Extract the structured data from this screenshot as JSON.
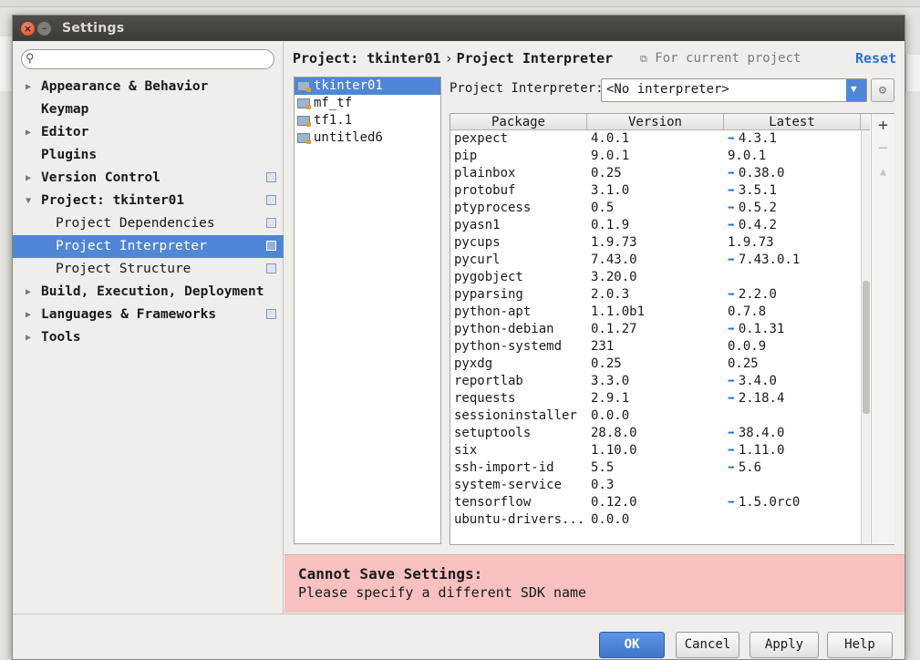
{
  "dialog": {
    "title": "Settings"
  },
  "search": {
    "placeholder": ""
  },
  "nav": [
    {
      "label": "Appearance & Behavior",
      "expandable": true,
      "bold": true
    },
    {
      "label": "Keymap",
      "expandable": false,
      "bold": true
    },
    {
      "label": "Editor",
      "expandable": true,
      "bold": true
    },
    {
      "label": "Plugins",
      "expandable": false,
      "bold": true
    },
    {
      "label": "Version Control",
      "expandable": true,
      "bold": true,
      "project_icon": true
    },
    {
      "label": "Project: tkinter01",
      "expandable": true,
      "expanded": true,
      "bold": true,
      "project_icon": true
    },
    {
      "label": "Project Dependencies",
      "child": true,
      "project_icon": true
    },
    {
      "label": "Project Interpreter",
      "child": true,
      "selected": true,
      "project_icon": true
    },
    {
      "label": "Project Structure",
      "child": true,
      "project_icon": true
    },
    {
      "label": "Build, Execution, Deployment",
      "expandable": true,
      "bold": true
    },
    {
      "label": "Languages & Frameworks",
      "expandable": true,
      "bold": true,
      "project_icon": true
    },
    {
      "label": "Tools",
      "expandable": true,
      "bold": true
    }
  ],
  "breadcrumb": {
    "project": "Project: tkinter01",
    "separator": "›",
    "page": "Project Interpreter"
  },
  "for_current_project": "For current project",
  "reset_label": "Reset",
  "projects": [
    {
      "name": "tkinter01",
      "selected": true
    },
    {
      "name": "mf_tf"
    },
    {
      "name": "tf1.1"
    },
    {
      "name": "untitled6"
    }
  ],
  "interpreter": {
    "label": "Project Interpreter:",
    "value": "<No interpreter>"
  },
  "packages": {
    "headers": [
      "Package",
      "Version",
      "Latest"
    ],
    "rows": [
      {
        "name": "pexpect",
        "version": "4.0.1",
        "latest": "4.3.1",
        "upgrade": true
      },
      {
        "name": "pip",
        "version": "9.0.1",
        "latest": "9.0.1",
        "upgrade": false
      },
      {
        "name": "plainbox",
        "version": "0.25",
        "latest": "0.38.0",
        "upgrade": true
      },
      {
        "name": "protobuf",
        "version": "3.1.0",
        "latest": "3.5.1",
        "upgrade": true
      },
      {
        "name": "ptyprocess",
        "version": "0.5",
        "latest": "0.5.2",
        "upgrade": true
      },
      {
        "name": "pyasn1",
        "version": "0.1.9",
        "latest": "0.4.2",
        "upgrade": true
      },
      {
        "name": "pycups",
        "version": "1.9.73",
        "latest": "1.9.73",
        "upgrade": false
      },
      {
        "name": "pycurl",
        "version": "7.43.0",
        "latest": "7.43.0.1",
        "upgrade": true
      },
      {
        "name": "pygobject",
        "version": "3.20.0",
        "latest": "",
        "upgrade": false
      },
      {
        "name": "pyparsing",
        "version": "2.0.3",
        "latest": "2.2.0",
        "upgrade": true
      },
      {
        "name": "python-apt",
        "version": "1.1.0b1",
        "latest": "0.7.8",
        "upgrade": false
      },
      {
        "name": "python-debian",
        "version": "0.1.27",
        "latest": "0.1.31",
        "upgrade": true
      },
      {
        "name": "python-systemd",
        "version": "231",
        "latest": "0.0.9",
        "upgrade": false
      },
      {
        "name": "pyxdg",
        "version": "0.25",
        "latest": "0.25",
        "upgrade": false
      },
      {
        "name": "reportlab",
        "version": "3.3.0",
        "latest": "3.4.0",
        "upgrade": true
      },
      {
        "name": "requests",
        "version": "2.9.1",
        "latest": "2.18.4",
        "upgrade": true
      },
      {
        "name": "sessioninstaller",
        "version": "0.0.0",
        "latest": "",
        "upgrade": false
      },
      {
        "name": "setuptools",
        "version": "28.8.0",
        "latest": "38.4.0",
        "upgrade": true
      },
      {
        "name": "six",
        "version": "1.10.0",
        "latest": "1.11.0",
        "upgrade": true
      },
      {
        "name": "ssh-import-id",
        "version": "5.5",
        "latest": "5.6",
        "upgrade": true
      },
      {
        "name": "system-service",
        "version": "0.3",
        "latest": "",
        "upgrade": false
      },
      {
        "name": "tensorflow",
        "version": "0.12.0",
        "latest": "1.5.0rc0",
        "upgrade": true
      },
      {
        "name": "ubuntu-drivers...",
        "version": "0.0.0",
        "latest": "",
        "upgrade": false
      }
    ]
  },
  "error": {
    "title": "Cannot Save Settings:",
    "message": "Please specify a different SDK name"
  },
  "buttons": {
    "ok": "OK",
    "cancel": "Cancel",
    "apply": "Apply",
    "help": "Help"
  },
  "colors": {
    "selection": "#4f86d6",
    "error_bg": "#f7c1c0",
    "link": "#2f6fd0"
  }
}
